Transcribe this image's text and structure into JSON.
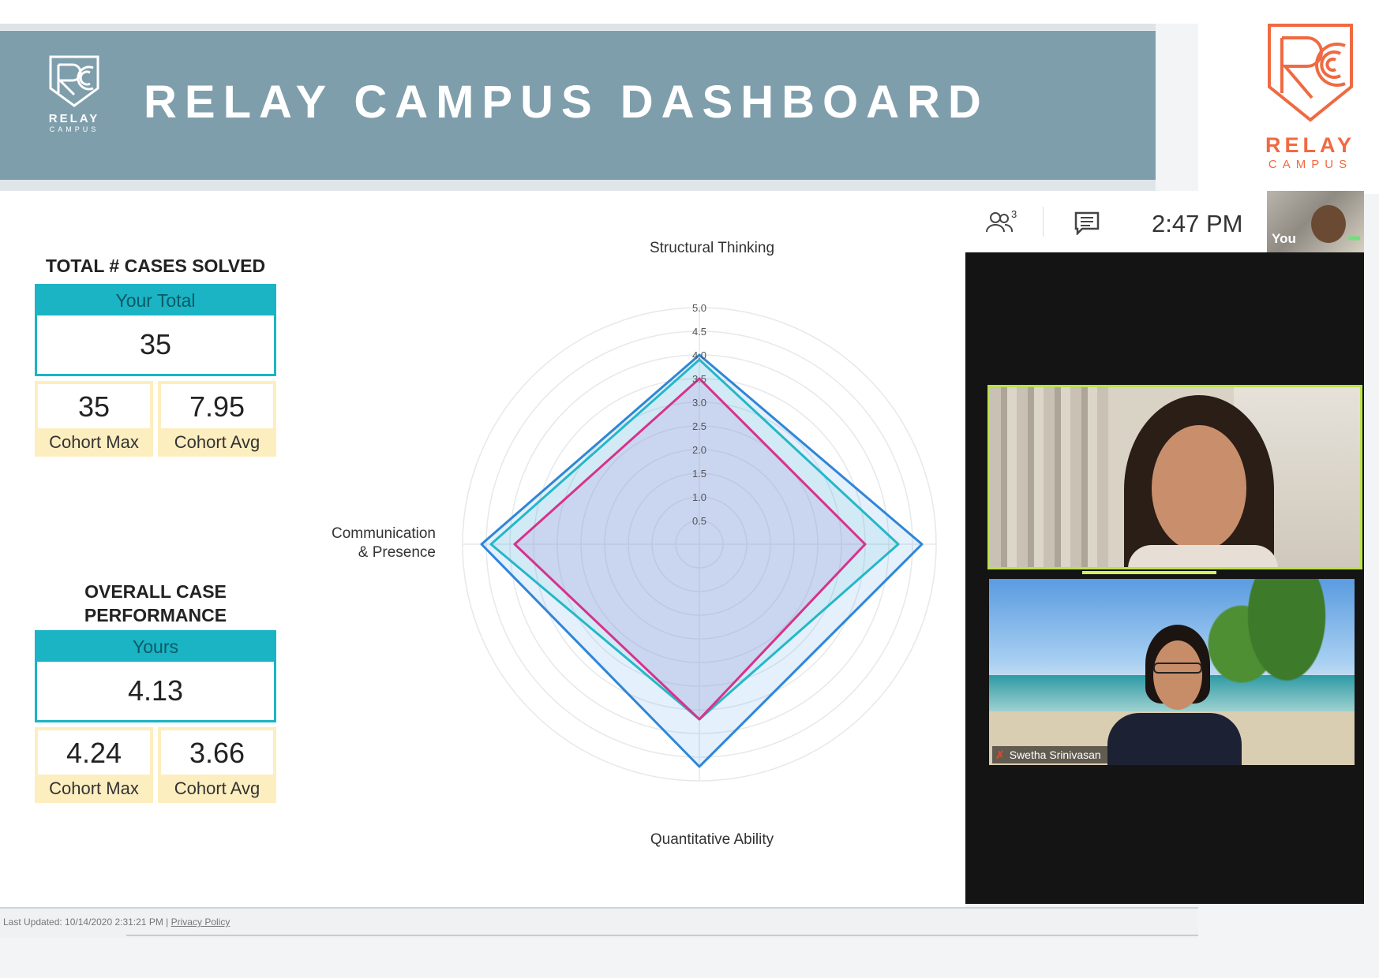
{
  "banner": {
    "title": "RELAY CAMPUS DASHBOARD",
    "logo_text_1": "RELAY",
    "logo_text_2": "CAMPUS"
  },
  "brand": {
    "text_1": "RELAY",
    "text_2": "CAMPUS",
    "color": "#ef6a42"
  },
  "cases": {
    "title": "TOTAL # CASES SOLVED",
    "head_label": "Your Total",
    "value": "35",
    "max_value": "35",
    "max_label": "Cohort Max",
    "avg_value": "7.95",
    "avg_label": "Cohort Avg"
  },
  "performance": {
    "title_line1": "OVERALL CASE",
    "title_line2": "PERFORMANCE",
    "head_label": "Yours",
    "value": "4.13",
    "max_value": "4.24",
    "max_label": "Cohort Max",
    "avg_value": "3.66",
    "avg_label": "Cohort Avg"
  },
  "chart_data": {
    "type": "radar",
    "axes": [
      "Structural Thinking",
      "Communication\n& Presence",
      "Quantitative Ability",
      ""
    ],
    "axis_labels": {
      "top": "Structural Thinking",
      "left_line1": "Communication",
      "left_line2": "& Presence",
      "bottom": "Quantitative Ability"
    },
    "ticks": [
      "0.5",
      "1.0",
      "1.5",
      "2.0",
      "2.5",
      "3.0",
      "3.5",
      "4.0",
      "4.5",
      "5.0"
    ],
    "rmax": 5.0,
    "series": [
      {
        "color": "#2f86d6",
        "fill": "rgba(120,180,240,0.20)",
        "values": [
          4.0,
          4.6,
          4.7,
          4.7
        ]
      },
      {
        "color": "#26b7c7",
        "fill": "rgba(60,190,200,0.10)",
        "values": [
          3.9,
          4.4,
          3.7,
          4.2
        ]
      },
      {
        "color": "#d6338a",
        "fill": "rgba(180,150,220,0.25)",
        "values": [
          3.5,
          3.9,
          3.7,
          3.5
        ]
      }
    ]
  },
  "footer": {
    "updated": "Last Updated: 10/14/2020 2:31:21 PM",
    "separator": "|",
    "privacy": "Privacy Policy"
  },
  "call": {
    "participants_count": "3",
    "time": "2:47 PM",
    "you_label": "You",
    "you_more": "•••",
    "participant2_name": "Swetha Srinivasan"
  }
}
